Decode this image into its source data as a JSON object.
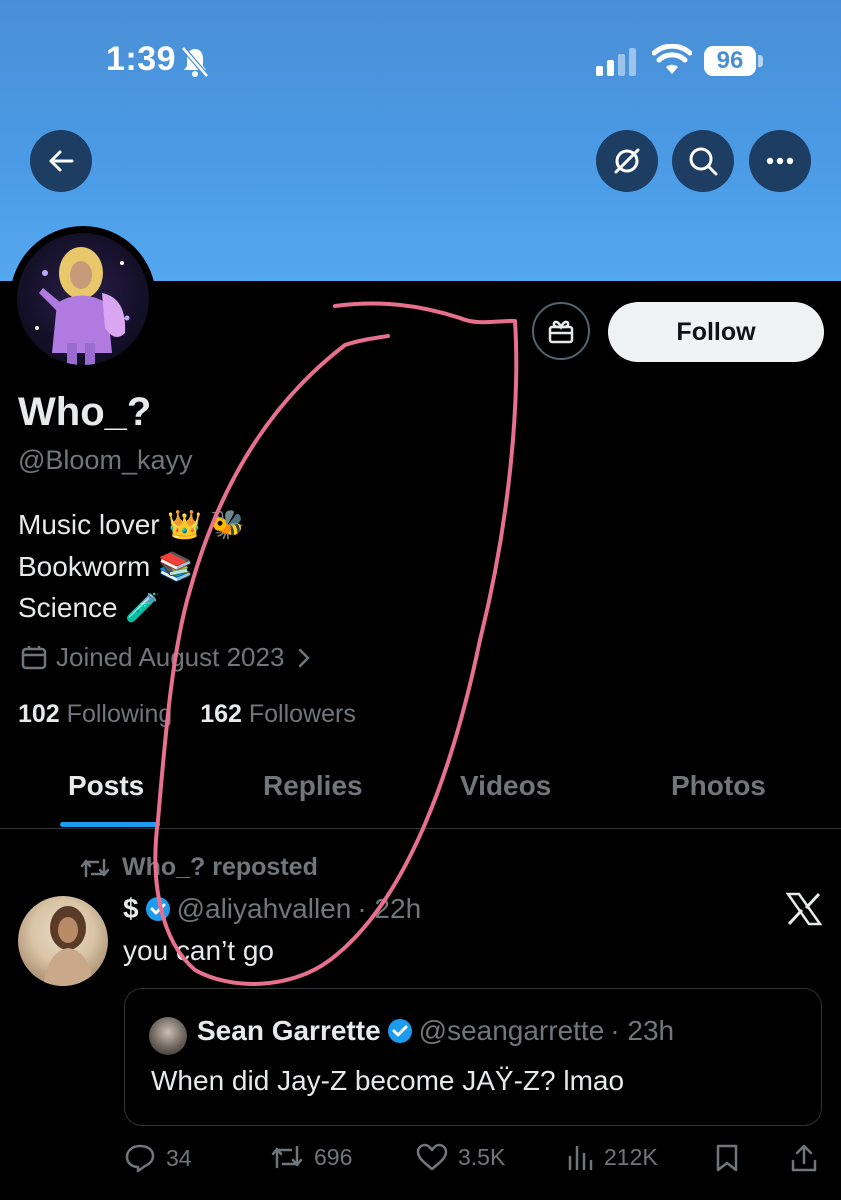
{
  "status_bar": {
    "time": "1:39",
    "battery": "96"
  },
  "profile": {
    "display_name": "Who_?",
    "handle": "@Bloom_kayy",
    "bio": [
      "Music lover 👑 🐝",
      "Bookworm 📚",
      "Science 🧪"
    ],
    "joined": "Joined August 2023",
    "following_count": "102",
    "following_label": "Following",
    "followers_count": "162",
    "followers_label": "Followers"
  },
  "actions": {
    "follow_label": "Follow"
  },
  "tabs": [
    {
      "label": "Posts",
      "active": true
    },
    {
      "label": "Replies",
      "active": false
    },
    {
      "label": "Videos",
      "active": false
    },
    {
      "label": "Photos",
      "active": false
    }
  ],
  "post": {
    "repost_label": "Who_? reposted",
    "author_name": "$",
    "author_handle": "@aliyahvallen",
    "time": "· 22h",
    "text": "you can’t go",
    "quote": {
      "author_name": "Sean Garrette",
      "author_handle": "@seangarrette",
      "time": "· 23h",
      "text": "When did Jay-Z become JAŸ-Z? lmao"
    },
    "stats": {
      "replies": "34",
      "reposts": "696",
      "likes": "3.5K",
      "views": "212K"
    }
  },
  "colors": {
    "accent": "#1d9bf0",
    "verified": "#1d9bf0",
    "annotation": "#e8708f",
    "banner": "#4b9be6"
  },
  "icons": [
    "back-arrow-icon",
    "grok-icon",
    "search-icon",
    "more-icon",
    "gift-icon",
    "calendar-icon",
    "chevron-right-icon",
    "repost-icon",
    "verified-icon",
    "x-logo-icon",
    "reply-icon",
    "like-icon",
    "views-icon",
    "bookmark-icon",
    "share-icon"
  ]
}
